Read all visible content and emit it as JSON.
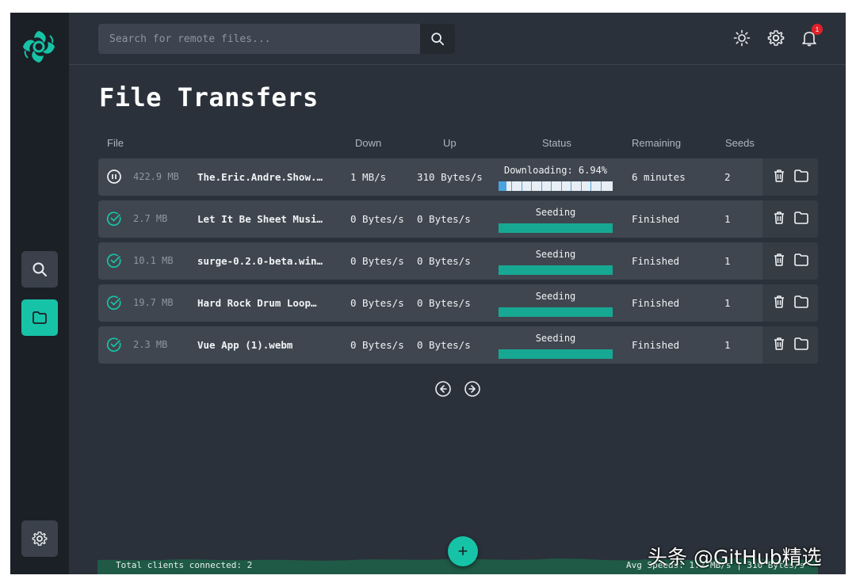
{
  "search": {
    "placeholder": "Search for remote files..."
  },
  "header": {
    "title": "File Transfers",
    "notification_count": "1"
  },
  "sidebar": {
    "icons": [
      "search-icon",
      "folder-icon",
      "gear-icon"
    ]
  },
  "colors": {
    "accent": "#17c3a6",
    "bg": "#2b313a",
    "sidebar": "#1b2026",
    "row": "#40464f",
    "bar": "#17a894",
    "badge": "#e0202a"
  },
  "table": {
    "columns": {
      "file": "File",
      "down": "Down",
      "up": "Up",
      "status": "Status",
      "remaining": "Remaining",
      "seeds": "Seeds"
    },
    "rows": [
      {
        "state": "downloading",
        "size": "422.9 MB",
        "name": "The.Eric.Andre.Show.…",
        "down": "1 MB/s",
        "up": "310 Bytes/s",
        "status": "Downloading: 6.94%",
        "progress": 0.0694,
        "remaining": "6 minutes",
        "seeds": "2"
      },
      {
        "state": "seeding",
        "size": "2.7 MB",
        "name": "Let It Be Sheet Musi…",
        "down": "0 Bytes/s",
        "up": "0 Bytes/s",
        "status": "Seeding",
        "progress": 1,
        "remaining": "Finished",
        "seeds": "1"
      },
      {
        "state": "seeding",
        "size": "10.1 MB",
        "name": "surge-0.2.0-beta.win…",
        "down": "0 Bytes/s",
        "up": "0 Bytes/s",
        "status": "Seeding",
        "progress": 1,
        "remaining": "Finished",
        "seeds": "1"
      },
      {
        "state": "seeding",
        "size": "19.7 MB",
        "name": "Hard Rock Drum Loop…",
        "down": "0 Bytes/s",
        "up": "0 Bytes/s",
        "status": "Seeding",
        "progress": 1,
        "remaining": "Finished",
        "seeds": "1"
      },
      {
        "state": "seeding",
        "size": "2.3 MB",
        "name": "Vue App (1).webm",
        "down": "0 Bytes/s",
        "up": "0 Bytes/s",
        "status": "Seeding",
        "progress": 1,
        "remaining": "Finished",
        "seeds": "1"
      }
    ]
  },
  "footer": {
    "clients": "Total clients connected: 2",
    "speeds": "Avg Speeds: 1.2 MB/s | 310 Bytes/s",
    "add_label": "+"
  },
  "watermark": "头条 @GitHub精选"
}
